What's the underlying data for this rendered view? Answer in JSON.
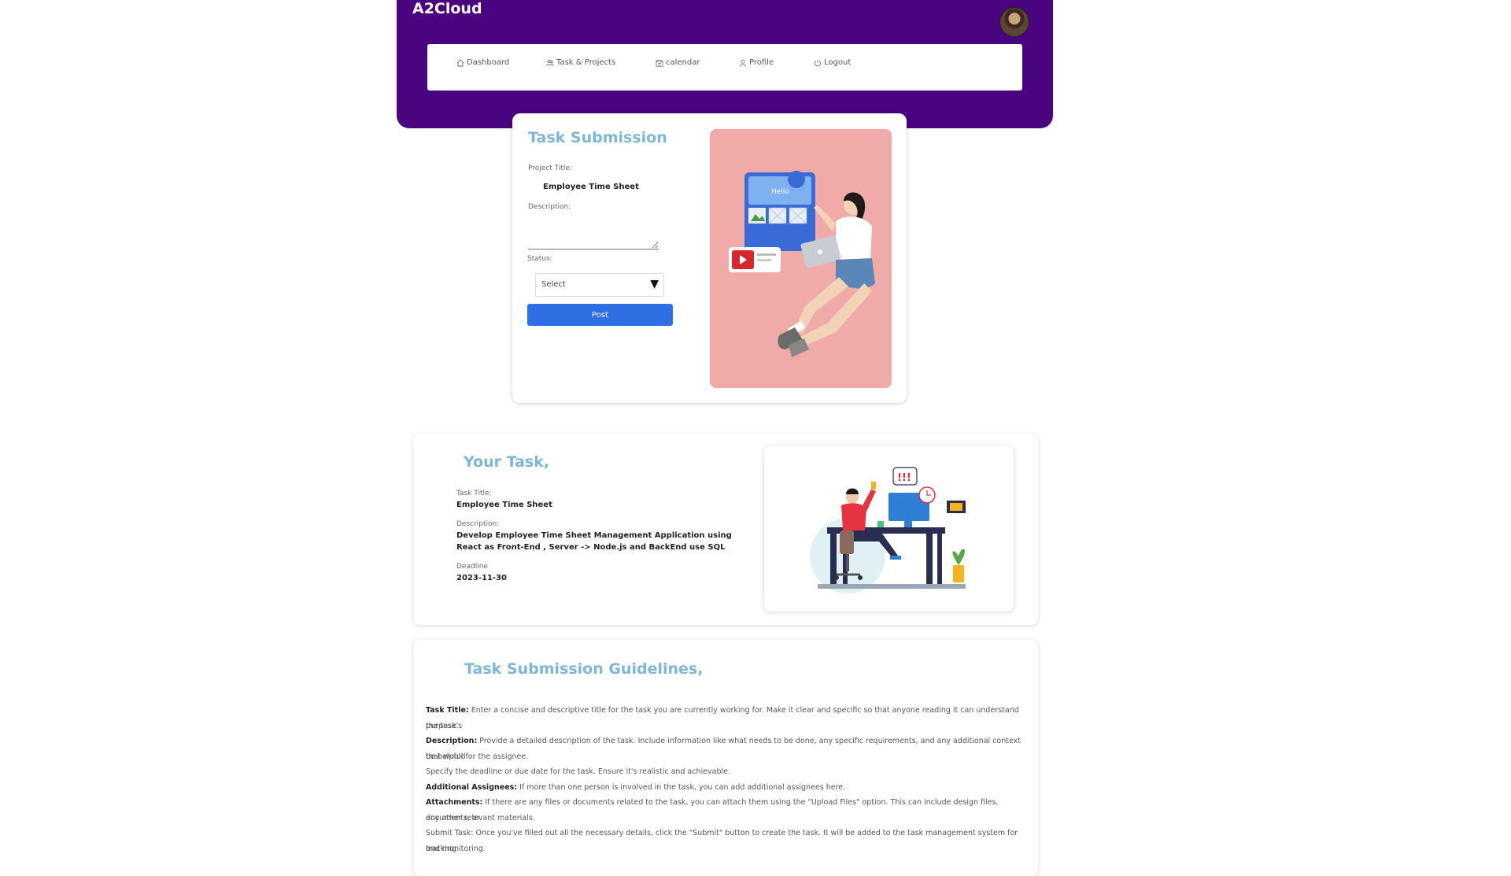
{
  "app": {
    "brand": "A2Cloud"
  },
  "nav": {
    "items": [
      {
        "label": "Dashboard",
        "icon": "home-icon"
      },
      {
        "label": "Task & Projects",
        "icon": "people-icon"
      },
      {
        "label": "calendar",
        "icon": "calendar-icon"
      },
      {
        "label": "Profile",
        "icon": "user-icon"
      },
      {
        "label": "Logout",
        "icon": "power-icon"
      }
    ]
  },
  "submission": {
    "title": "Task Submission",
    "project_title_label": "Project Title:",
    "project_title_value": "Employee Time Sheet",
    "description_label": "Description:",
    "description_value": "",
    "status_label": "Status:",
    "status_selected": "Select",
    "post_label": "Post",
    "illustration_text": "Hello"
  },
  "task": {
    "heading": "Your Task,",
    "title_label": "Task Title:",
    "title_value": "Employee Time Sheet",
    "description_label": "Description:",
    "description_line1": "Develop Employee Time Sheet Management Application using",
    "description_line2": "React as Front-End , Server -> Node.js and BackEnd use SQL",
    "deadline_label": "Deadline",
    "deadline_value": "2023-11-30",
    "illustration_alert": "!!!"
  },
  "guidelines": {
    "heading": "Task Submission Guidelines,",
    "lines": [
      {
        "term": "Task Title:",
        "text": " Enter a concise and descriptive title for the task you are currently working for. Make it clear and specific so that anyone reading it can understand the task's"
      },
      {
        "term": "",
        "text": "purpose."
      },
      {
        "term": "Description:",
        "text": " Provide a detailed description of the task. Include information like what needs to be done, any specific requirements, and any additional context that would"
      },
      {
        "term": "",
        "text": "be helpful for the assignee."
      },
      {
        "term": "",
        "text": "Specify the deadline or due date for the task. Ensure it's realistic and achievable."
      },
      {
        "term": "Additional Assignees:",
        "text": " If more than one person is involved in the task, you can add additional assignees here."
      },
      {
        "term": "Attachments:",
        "text": " If there are any files or documents related to the task, you can attach them using the \"Upload Files\" option. This can include design files, documents, or"
      },
      {
        "term": "",
        "text": "any other relevant materials."
      },
      {
        "term": "",
        "text": "Submit Task: Once you've filled out all the necessary details, click the \"Submit\" button to create the task. It will be added to the task management system for tracking"
      },
      {
        "term": "",
        "text": "and monitoring."
      }
    ]
  }
}
